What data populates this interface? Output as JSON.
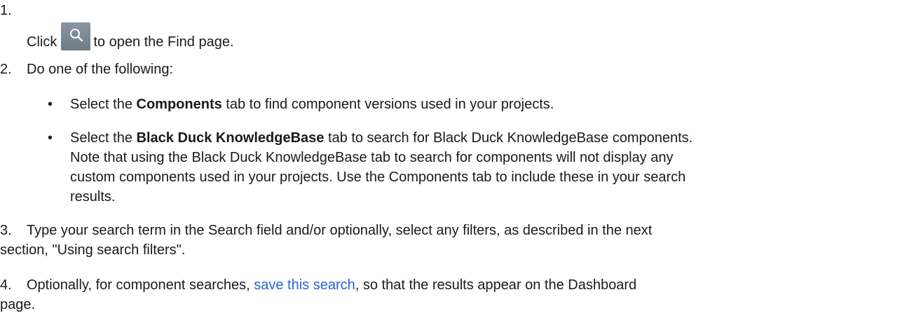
{
  "steps": {
    "s1": {
      "num": "1.",
      "prefix": "Click",
      "icon": "search-icon",
      "suffix": "to open the Find page."
    },
    "s2": {
      "num": "2.",
      "text": "Do one of the following:",
      "bullet1": {
        "marker": "•",
        "pre": "Select the",
        "bold": "Components",
        "post": "tab to find component versions used in your projects."
      },
      "bullet2": {
        "marker": "•",
        "pre": "Select the",
        "bold": "Black Duck KnowledgeBase",
        "post": "tab to search for Black Duck KnowledgeBase components.",
        "line2": "Note that using the Black Duck KnowledgeBase tab to search for components will not display any",
        "line3": "custom components used in your projects. Use the Components tab to include these in your search",
        "line4": "results."
      }
    },
    "s3": {
      "num": "3.",
      "line1": "Type your search term in the Search field and/or optionally, select any filters, as described in the next",
      "line2": "section, \"Using search filters\"."
    },
    "s4": {
      "num": "4.",
      "pre": "Optionally, for component searches,",
      "link": "save this search",
      "post": ", so that the results appear on the Dashboard",
      "line2": "page."
    }
  },
  "colors": {
    "link": "#2a63d4",
    "icon_button": "#7b8792"
  }
}
